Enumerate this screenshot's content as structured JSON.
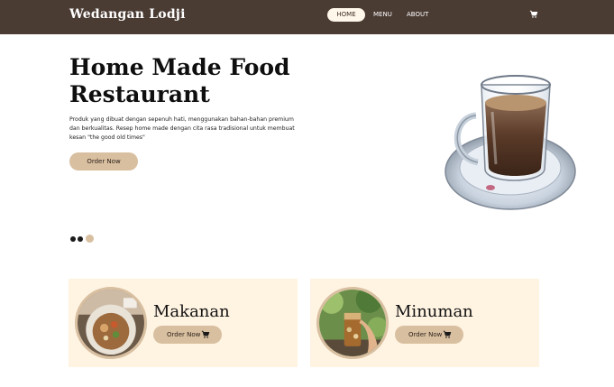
{
  "nav": {
    "brand": "Wedangan Lodji",
    "links": {
      "home": "HOME",
      "menu": "MENU",
      "about": "ABOUT"
    },
    "cart_icon": "cart-icon"
  },
  "hero": {
    "title_line1": "Home Made Food",
    "title_line2": "Restaurant",
    "description": "Produk yang dibuat dengan sepenuh hati, menggunakan bahan-bahan premium dan berkualitas. Resep home made dengan cita rasa tradisional untuk membuat kesan \"the good old times\"",
    "cta": "Order Now"
  },
  "carousel": {
    "total_slides": 3,
    "active_slide": 3
  },
  "cards": [
    {
      "title": "Makanan",
      "cta": "Order Now"
    },
    {
      "title": "Minuman",
      "cta": "Order Now"
    }
  ],
  "colors": {
    "navbar": "#4a3b33",
    "accent": "#d8bfa0",
    "card_bg": "#fff3e2",
    "nav_active_bg": "#fff7ea"
  }
}
